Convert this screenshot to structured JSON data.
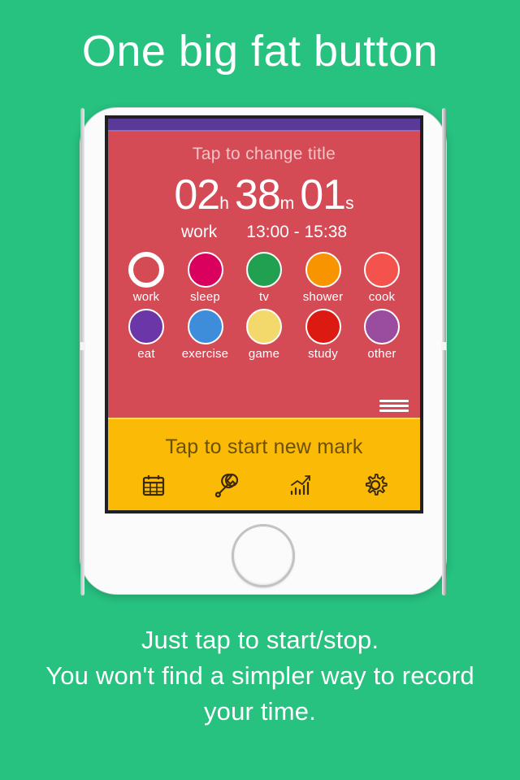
{
  "headline": "One big fat button",
  "caption": {
    "lines": [
      "Just tap to start/stop.",
      "You won't find a simpler way to record",
      "your time."
    ]
  },
  "colors": {
    "background_green": "#27c180",
    "panel_red": "#d44b55",
    "panel_yellow": "#fbba06",
    "status_purple": "#5a3a99",
    "status_purple_line": "#8d6fc4",
    "toolbar_icon": "#3a2a0a"
  },
  "app": {
    "title_prompt": "Tap to change title",
    "timer": {
      "hours": "02",
      "hours_unit": "h",
      "minutes": "38",
      "minutes_unit": "m",
      "seconds": "01",
      "seconds_unit": "s"
    },
    "current_category": "work",
    "time_range": "13:00 - 15:38",
    "categories": [
      {
        "label": "work",
        "color": "#d44b55",
        "selected": true
      },
      {
        "label": "sleep",
        "color": "#d9005e",
        "selected": false
      },
      {
        "label": "tv",
        "color": "#22a052",
        "selected": false
      },
      {
        "label": "shower",
        "color": "#f79400",
        "selected": false
      },
      {
        "label": "cook",
        "color": "#f4524d",
        "selected": false
      },
      {
        "label": "eat",
        "color": "#6b36a8",
        "selected": false
      },
      {
        "label": "exercise",
        "color": "#3d8dda",
        "selected": false
      },
      {
        "label": "game",
        "color": "#f3d96b",
        "selected": false
      },
      {
        "label": "study",
        "color": "#dc1a12",
        "selected": false
      },
      {
        "label": "other",
        "color": "#9a4d9e",
        "selected": false
      }
    ],
    "menu_icon": "hamburger-icon",
    "start_button_label": "Tap to start new mark",
    "toolbar": [
      {
        "name": "calendar-icon",
        "label": "Calendar"
      },
      {
        "name": "wrench-icon",
        "label": "Tools"
      },
      {
        "name": "chart-icon",
        "label": "Statistics"
      },
      {
        "name": "gear-icon",
        "label": "Settings"
      }
    ]
  }
}
